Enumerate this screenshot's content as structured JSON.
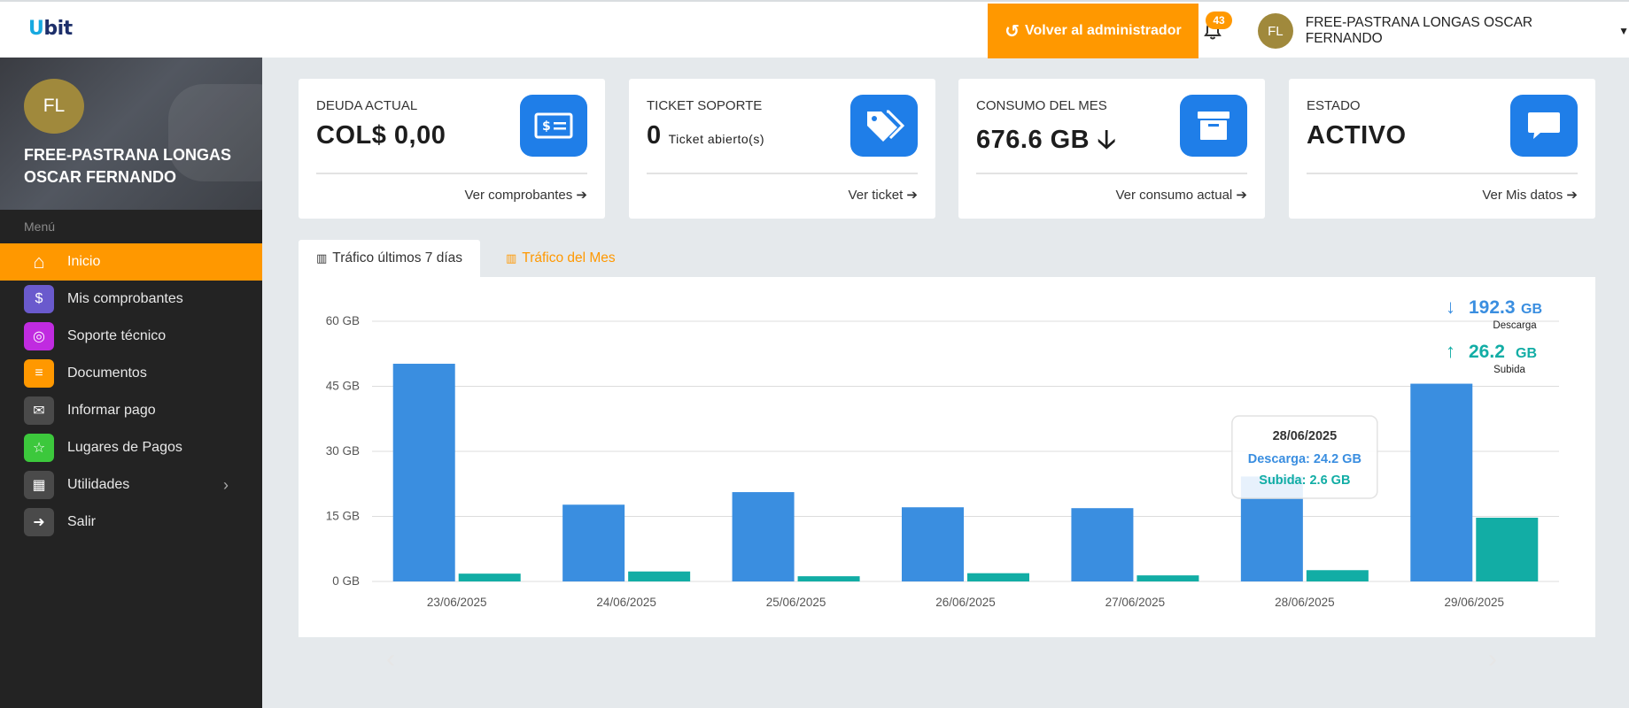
{
  "topbar": {
    "logo": "Ubit",
    "back_button": "Volver al administrador",
    "notifications_count": "43",
    "user_initials": "FL",
    "user_name": "FREE-PASTRANA LONGAS OSCAR FERNANDO"
  },
  "sidebar": {
    "profile_initials": "FL",
    "profile_name": "FREE-PASTRANA LONGAS OSCAR FERNANDO",
    "menu_label": "Menú",
    "items": [
      {
        "label": "Inicio",
        "icon": "home-icon",
        "color": "#ff9800"
      },
      {
        "label": "Mis comprobantes",
        "icon": "invoice-icon",
        "color": "#6a5acd"
      },
      {
        "label": "Soporte técnico",
        "icon": "lifebuoy-icon",
        "color": "#c02be0"
      },
      {
        "label": "Documentos",
        "icon": "document-icon",
        "color": "#ff9800"
      },
      {
        "label": "Informar pago",
        "icon": "envelope-icon",
        "color": "#4a4a4a"
      },
      {
        "label": "Lugares de Pagos",
        "icon": "star-icon",
        "color": "#3cc83c"
      },
      {
        "label": "Utilidades",
        "icon": "toolbox-icon",
        "color": "#4a4a4a"
      },
      {
        "label": "Salir",
        "icon": "logout-icon",
        "color": "#4a4a4a"
      }
    ]
  },
  "cards": [
    {
      "title": "DEUDA ACTUAL",
      "value": "COL$ 0,00",
      "sub": "",
      "link": "Ver comprobantes",
      "icon": "money-bill-icon"
    },
    {
      "title": "TICKET SOPORTE",
      "value": "0",
      "sub": "Ticket abierto(s)",
      "link": "Ver ticket",
      "icon": "tags-icon"
    },
    {
      "title": "CONSUMO DEL MES",
      "value": "676.6 GB",
      "sub": "",
      "link": "Ver consumo actual",
      "icon": "archive-icon"
    },
    {
      "title": "ESTADO",
      "value": "ACTIVO",
      "sub": "",
      "link": "Ver Mis datos",
      "icon": "message-icon"
    }
  ],
  "tabs": {
    "active": "Tráfico últimos 7 días",
    "inactive": "Tráfico del Mes"
  },
  "colors": {
    "accent": "#ff9800",
    "download": "#3a8ee0",
    "upload": "#12ada5",
    "card_icon": "#1f7ee8",
    "sidebar": "#232323"
  },
  "chart_data": {
    "type": "bar",
    "categories": [
      "23/06/2025",
      "24/06/2025",
      "25/06/2025",
      "26/06/2025",
      "27/06/2025",
      "28/06/2025",
      "29/06/2025"
    ],
    "series": [
      {
        "name": "Descarga",
        "values": [
          50.2,
          17.7,
          20.6,
          17.1,
          16.9,
          24.2,
          45.6
        ]
      },
      {
        "name": "Subida",
        "values": [
          1.8,
          2.3,
          1.2,
          1.9,
          1.4,
          2.6,
          14.7
        ]
      }
    ],
    "ylim": [
      0,
      60
    ],
    "yticks": [
      "0 GB",
      "15 GB",
      "30 GB",
      "45 GB",
      "60 GB"
    ],
    "totals": {
      "download_value": "192.3",
      "download_unit": "GB",
      "download_label": "Descarga",
      "upload_value": "26.2",
      "upload_unit": "GB",
      "upload_label": "Subida"
    },
    "tooltip": {
      "date": "28/06/2025",
      "download": "Descarga: 24.2 GB",
      "upload": "Subida: 2.6 GB"
    },
    "grid": true
  }
}
